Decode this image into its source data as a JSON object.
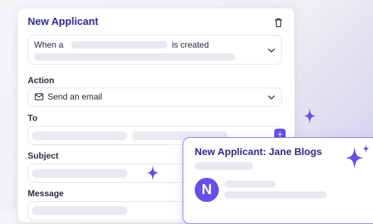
{
  "card": {
    "title": "New Applicant",
    "trigger": {
      "prefix": "When a",
      "suffix": "is created"
    },
    "action": {
      "label": "Action",
      "value": "Send an email"
    },
    "to": {
      "label": "To"
    },
    "subject": {
      "label": "Subject"
    },
    "message": {
      "label": "Message"
    }
  },
  "notification": {
    "title": "New Applicant: Jane Blogs",
    "avatar_initial": "N"
  },
  "colors": {
    "accent": "#6a4ee8",
    "title": "#2d2a87",
    "skeleton": "#e9e9ef",
    "sparkle": "#6a4ee8"
  }
}
